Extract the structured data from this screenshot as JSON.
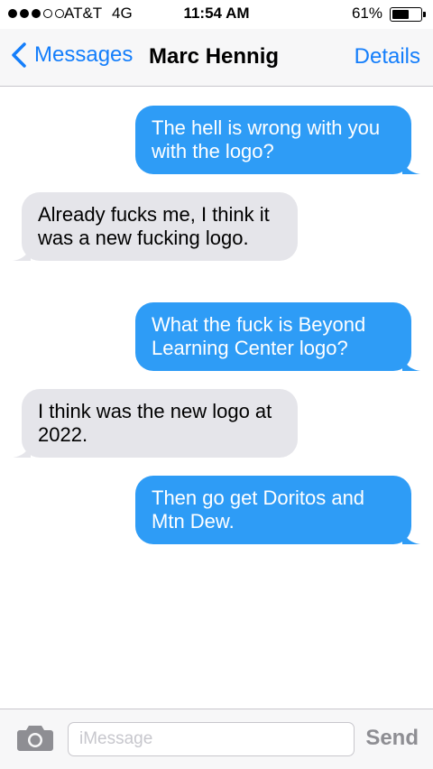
{
  "status_bar": {
    "carrier": "AT&T",
    "network": "4G",
    "time": "11:54 AM",
    "battery_percent_label": "61%",
    "battery_level": 0.61,
    "signal_bars_filled": 3,
    "signal_bars_total": 5
  },
  "nav": {
    "back_label": "Messages",
    "contact_name": "Marc Hennig",
    "details_label": "Details"
  },
  "messages": [
    {
      "direction": "sent",
      "text": "The hell is wrong with you with the logo?"
    },
    {
      "direction": "received",
      "text": "Already fucks me, I think it was a new fucking logo."
    },
    {
      "direction": "sent",
      "text": "What the fuck is Beyond Learning Center logo?"
    },
    {
      "direction": "received",
      "text": "I think was the new logo at 2022."
    },
    {
      "direction": "sent",
      "text": "Then go get Doritos and Mtn Dew."
    }
  ],
  "input_bar": {
    "placeholder": "iMessage",
    "value": "",
    "send_label": "Send"
  },
  "colors": {
    "accent": "#147efb",
    "sent_bubble": "#2e9cf6",
    "received_bubble": "#e5e5ea",
    "send_disabled": "#8e8e93"
  }
}
